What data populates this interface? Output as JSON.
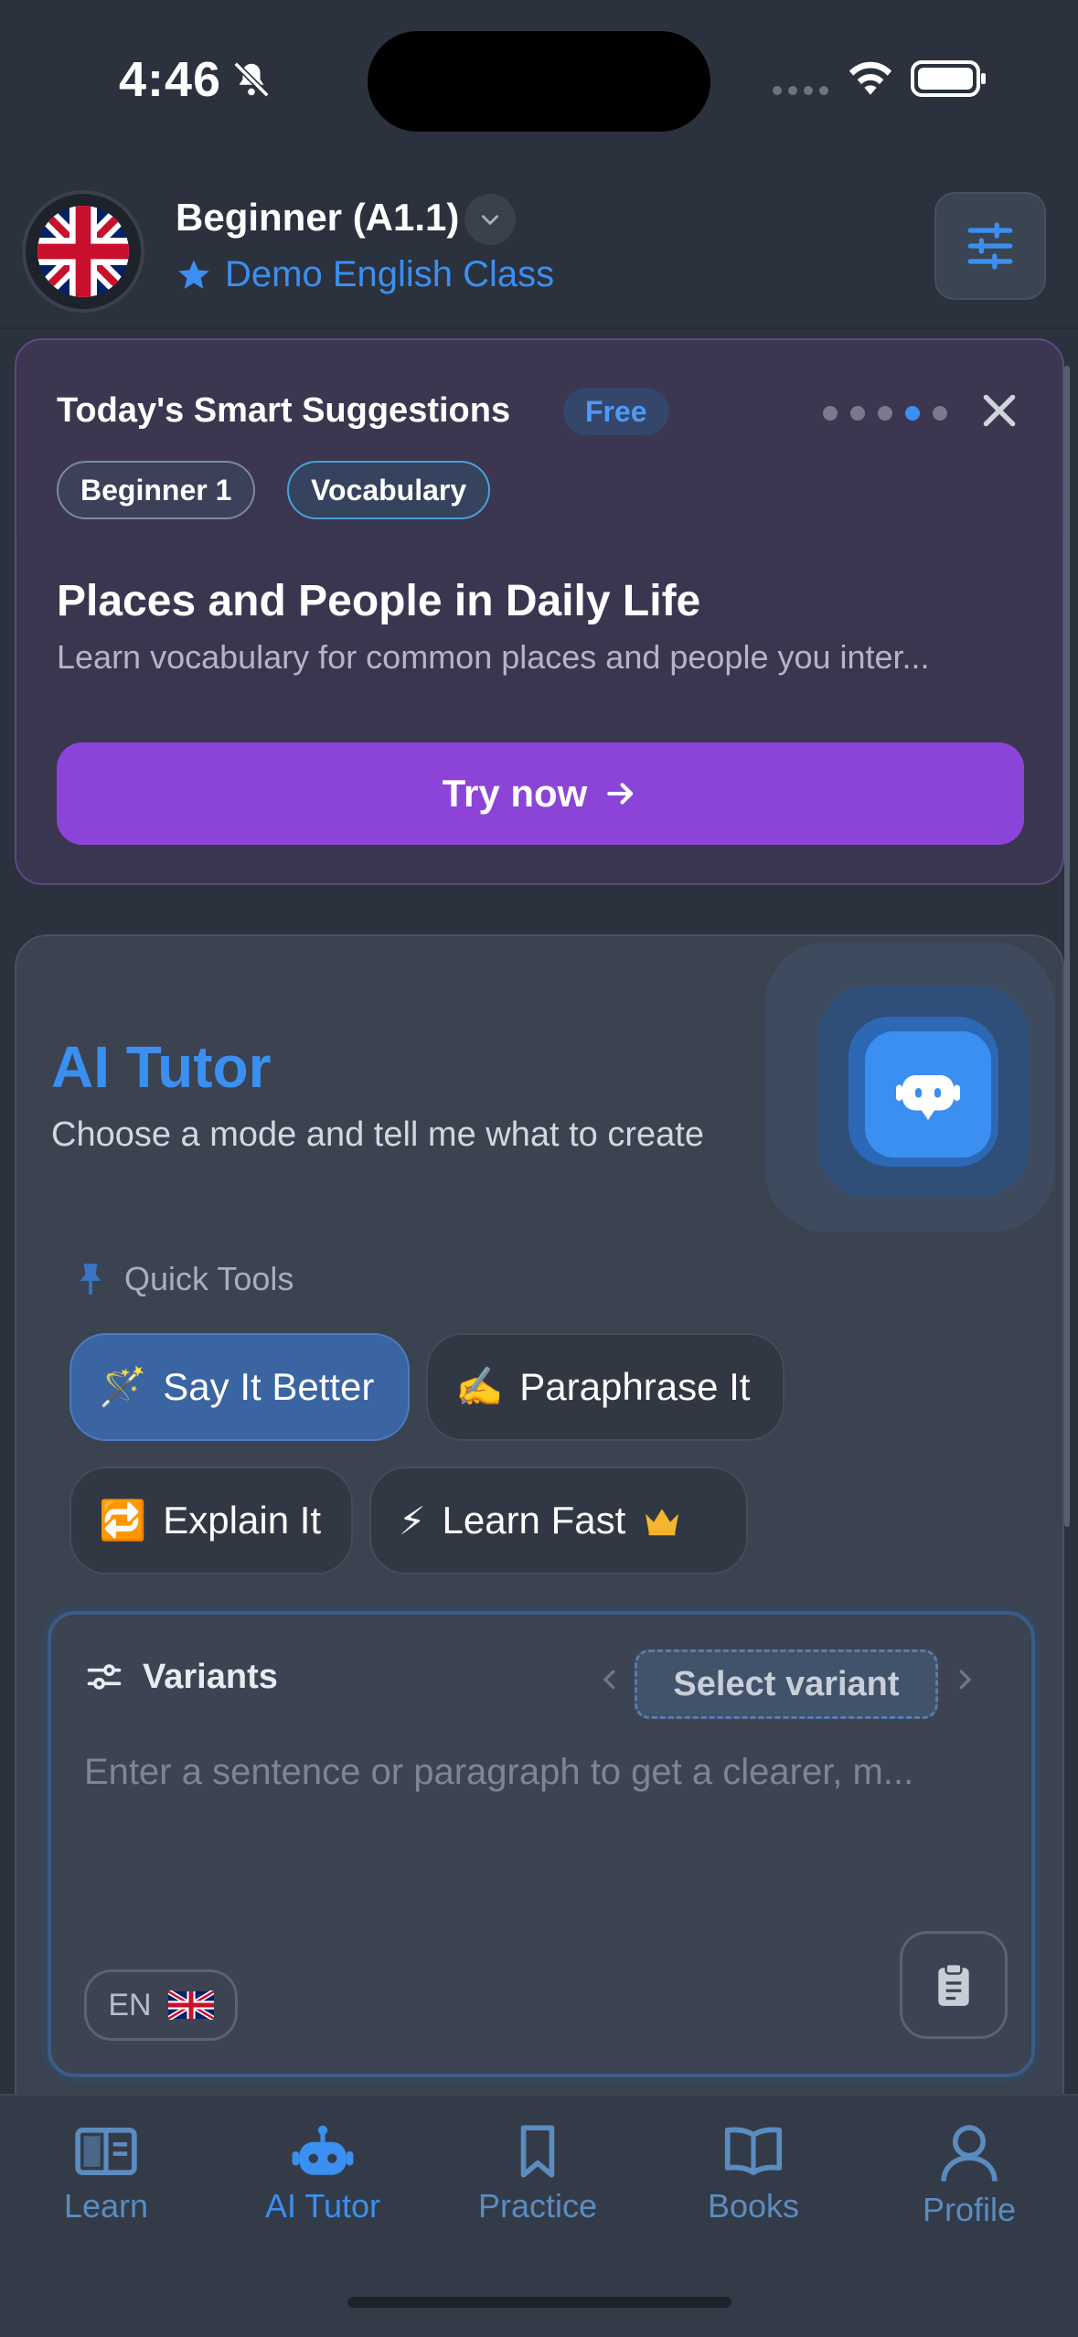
{
  "status_bar": {
    "time": "4:46"
  },
  "header": {
    "level": "Beginner (A1.1)",
    "class_name": "Demo English Class"
  },
  "suggestions": {
    "title": "Today's Smart Suggestions",
    "badge": "Free",
    "tags": [
      "Beginner 1",
      "Vocabulary"
    ],
    "lesson_title": "Places and People in Daily Life",
    "lesson_desc": "Learn vocabulary for common places and people you inter...",
    "cta_label": "Try now",
    "pager_count": 5,
    "pager_active_index": 3
  },
  "tutor": {
    "title": "AI Tutor",
    "subtitle": "Choose a mode and tell me what to create",
    "quick_tools_label": "Quick Tools",
    "tools": [
      {
        "emoji": "🪄",
        "label": "Say It Better",
        "active": true
      },
      {
        "emoji": "✍️",
        "label": "Paraphrase It",
        "active": false
      },
      {
        "emoji": "🔁",
        "label": "Explain It",
        "active": false
      },
      {
        "emoji": "⚡",
        "label": "Learn Fast",
        "active": false,
        "premium": true
      }
    ],
    "variants_label": "Variants",
    "select_variant_label": "Select variant",
    "input_placeholder": "Enter a sentence or paragraph to get a clearer, m...",
    "language_code": "EN"
  },
  "tabs": [
    {
      "label": "Learn",
      "icon": "book-open-icon"
    },
    {
      "label": "AI Tutor",
      "icon": "robot-icon",
      "active": true
    },
    {
      "label": "Practice",
      "icon": "bookmark-icon"
    },
    {
      "label": "Books",
      "icon": "books-icon"
    },
    {
      "label": "Profile",
      "icon": "user-icon"
    }
  ],
  "colors": {
    "accent": "#3b8ff0",
    "cta": "#8c44d8",
    "background": "#2b313d"
  }
}
